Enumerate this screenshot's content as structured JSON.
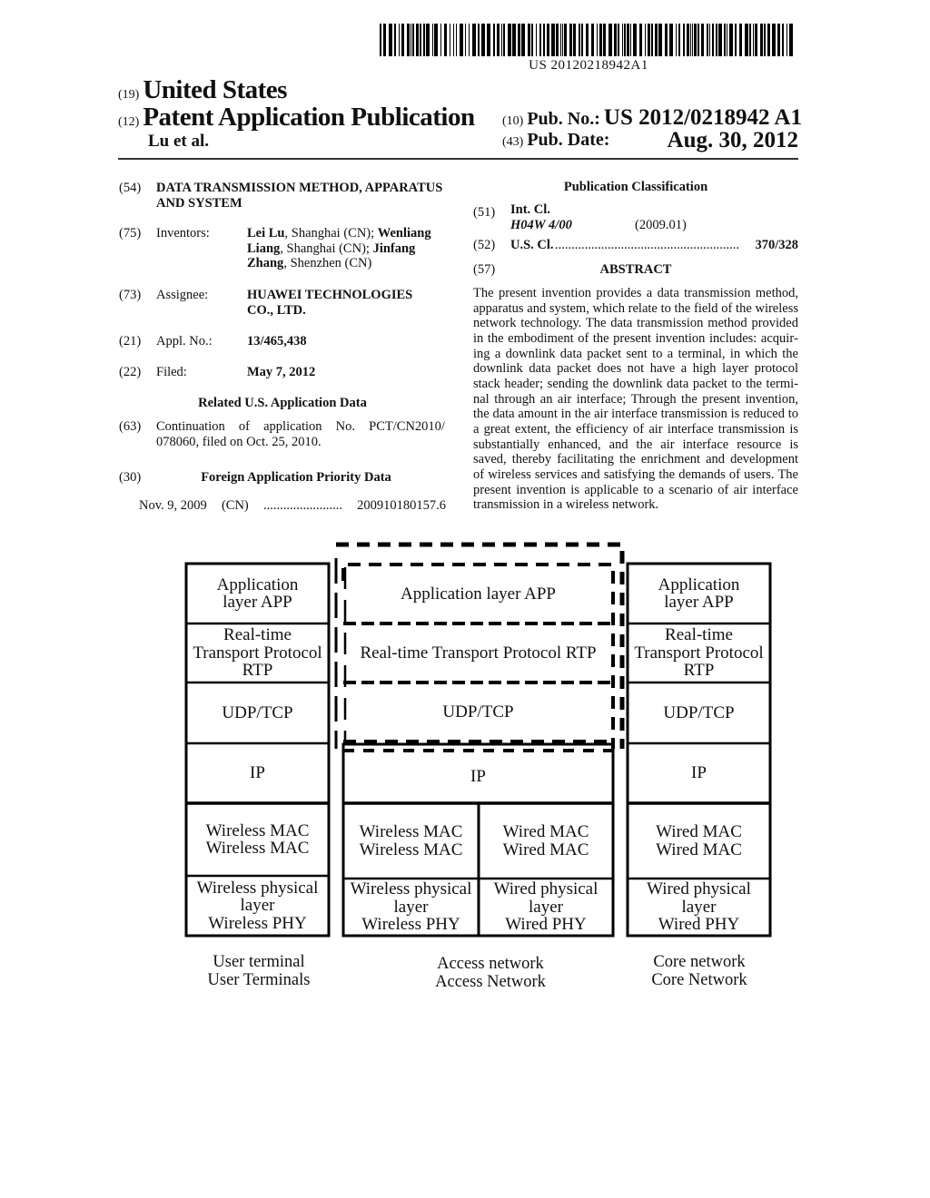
{
  "barcode": {
    "number": "US 20120218942A1"
  },
  "header": {
    "country_code": "(19)",
    "country": "United States",
    "type_code": "(12)",
    "type": "Patent Application Publication",
    "authors": "Lu et al.",
    "pub_no_code": "(10)",
    "pub_no_label": "Pub. No.:",
    "pub_no": "US 2012/0218942 A1",
    "pub_date_code": "(43)",
    "pub_date_label": "Pub. Date:",
    "pub_date": "Aug. 30, 2012"
  },
  "biblio": {
    "title": {
      "code": "(54)",
      "text": "DATA TRANSMISSION METHOD, APPARATUS AND SYSTEM"
    },
    "inventors": {
      "code": "(75)",
      "label": "Inventors:",
      "people": [
        {
          "name": "Lei Lu",
          "location": ", Shanghai (CN); "
        },
        {
          "name": "Wenliang Liang",
          "location": ", Shanghai (CN); "
        },
        {
          "name": "Jinfang Zhang",
          "location": ", Shenzhen (CN)"
        }
      ]
    },
    "assignee": {
      "code": "(73)",
      "label": "Assignee:",
      "value": "HUAWEI TECHNOLOGIES CO., LTD."
    },
    "appl_no": {
      "code": "(21)",
      "label": "Appl. No.:",
      "value": "13/465,438"
    },
    "filed": {
      "code": "(22)",
      "label": "Filed:",
      "value": "May 7, 2012"
    },
    "related_heading": "Related U.S. Application Data",
    "continuation": {
      "code": "(63)",
      "line1_words": [
        "Continuation",
        "of",
        "application",
        "No.",
        "PCT/CN2010/"
      ],
      "line2": "078060, filed on Oct. 25, 2010."
    },
    "foreign": {
      "code": "(30)",
      "heading": "Foreign Application Priority Data",
      "date": "Nov. 9, 2009",
      "country": "(CN)",
      "dots": "........................",
      "number": "200910180157.6"
    }
  },
  "classification": {
    "heading": "Publication Classification",
    "int_cl": {
      "code": "(51)",
      "label": "Int. Cl.",
      "class": "H04W 4/00",
      "version": "(2009.01)"
    },
    "us_cl": {
      "code": "(52)",
      "label": "U.S. Cl.",
      "dots": "........................................................",
      "value": "370/328"
    }
  },
  "abstract": {
    "code": "(57)",
    "heading": "ABSTRACT",
    "text": "The present invention provides a data transmission method, apparatus and system, which relate to the field of the wireless network technology. The data transmission method provided in the embodiment of the present invention includes: acquir­ing a downlink data packet sent to a terminal, in which the downlink data packet does not have a high layer protocol stack header; sending the downlink data packet to the termi­nal through an air interface; Through the present invention, the data amount in the air interface transmission is reduced to a great extent, the efficiency of air interface transmission is substantially enhanced, and the air interface resource is saved, thereby facilitating the enrichment and development of wireless services and satisfying the demands of users. The present invention is applicable to a scenario of air interface transmission in a wireless network."
  },
  "diagram": {
    "user_terminal": {
      "layers": [
        "Application\nlayer APP",
        "Real-time\nTransport Protocol\nRTP",
        "UDP/TCP",
        "IP",
        "Wireless MAC\nWireless MAC",
        "Wireless physical\nlayer\nWireless PHY"
      ],
      "label": "User terminal\nUser Terminals"
    },
    "access_network": {
      "app": "Application layer APP",
      "rtp": "Real-time Transport Protocol RTP",
      "udp": "UDP/TCP",
      "ip": "IP",
      "mac_wireless": "Wireless MAC\nWireless MAC",
      "mac_wired": "Wired MAC\nWired MAC",
      "phy_wireless": "Wireless physical\nlayer\nWireless PHY",
      "phy_wired": "Wired physical\nlayer\nWired PHY",
      "label": "Access network\nAccess Network"
    },
    "core_network": {
      "layers": [
        "Application\nlayer APP",
        "Real-time\nTransport Protocol\nRTP",
        "UDP/TCP",
        "IP",
        "Wired MAC\nWired MAC",
        "Wired physical\nlayer\nWired PHY"
      ],
      "label": "Core network\nCore Network"
    }
  }
}
